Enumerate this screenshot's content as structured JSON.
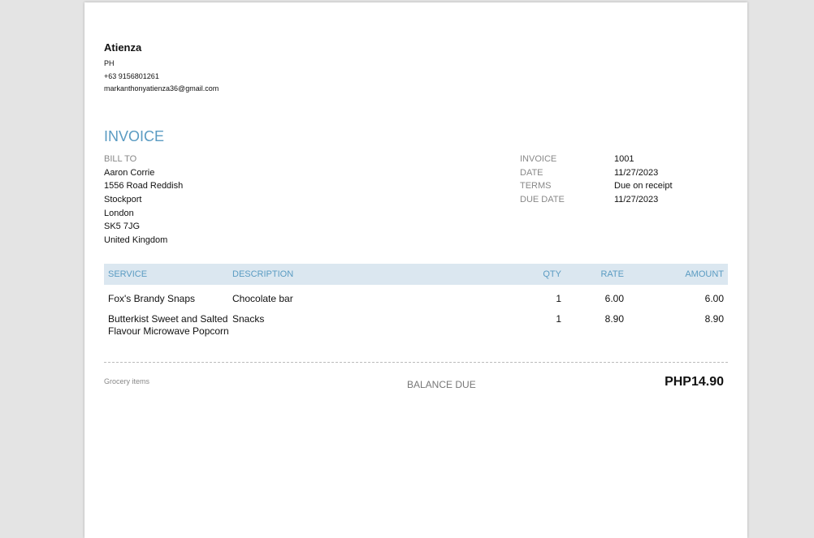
{
  "from": {
    "name": "Atienza",
    "country": "PH",
    "phone": "+63 9156801261",
    "email": "markanthonyatienza36@gmail.com"
  },
  "title": "INVOICE",
  "bill_to": {
    "label": "BILL TO",
    "lines": [
      "Aaron Corrie",
      "1556 Road Reddish",
      "Stockport",
      "London",
      "SK5 7JG",
      "United Kingdom"
    ]
  },
  "meta": [
    {
      "label": "INVOICE",
      "value": "1001"
    },
    {
      "label": "DATE",
      "value": "11/27/2023"
    },
    {
      "label": "TERMS",
      "value": "Due on receipt"
    },
    {
      "label": "DUE DATE",
      "value": "11/27/2023"
    }
  ],
  "table": {
    "headers": {
      "service": "SERVICE",
      "description": "DESCRIPTION",
      "qty": "QTY",
      "rate": "RATE",
      "amount": "AMOUNT"
    },
    "rows": [
      {
        "service": "Fox's Brandy Snaps",
        "description": "Chocolate bar",
        "qty": "1",
        "rate": "6.00",
        "amount": "6.00"
      },
      {
        "service": "Butterkist Sweet and Salted Flavour Microwave Popcorn",
        "description": "Snacks",
        "qty": "1",
        "rate": "8.90",
        "amount": "8.90"
      }
    ]
  },
  "footer": {
    "note": "Grocery items",
    "balance_label": "BALANCE DUE",
    "balance": "PHP14.90"
  }
}
